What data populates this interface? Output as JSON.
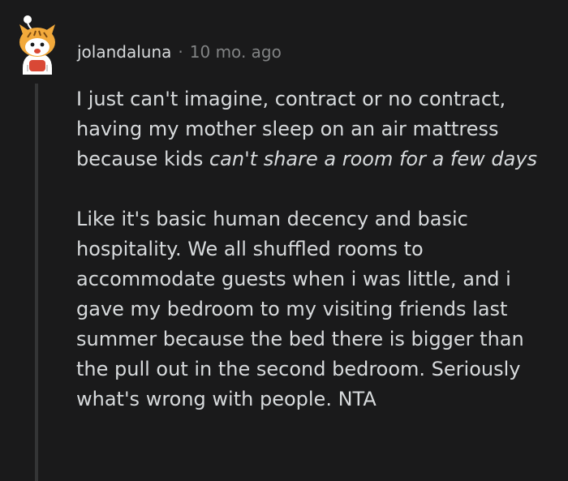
{
  "comment": {
    "author": "jolandaluna",
    "separator": "·",
    "time": "10 mo. ago",
    "paragraphs": [
      {
        "text_before": "I just can't imagine, contract or no contract, having my mother sleep on an air mattress because kids ",
        "emphasis": "can't share a room for a few days"
      },
      {
        "text": "Like it's basic human decency and basic hospitality. We all shuffled rooms to accommodate guests when i was little, and i gave my bedroom to my visiting friends last summer because the bed there is bigger than the pull out in the second bedroom. Seriously what's wrong with people. NTA"
      }
    ]
  },
  "colors": {
    "background": "#1a1a1b",
    "text": "#d7dadc",
    "muted": "#818384",
    "thread_line": "#343536",
    "avatar_orange": "#f2a93b"
  },
  "icons": {
    "avatar": "snoo-avatar-icon"
  }
}
